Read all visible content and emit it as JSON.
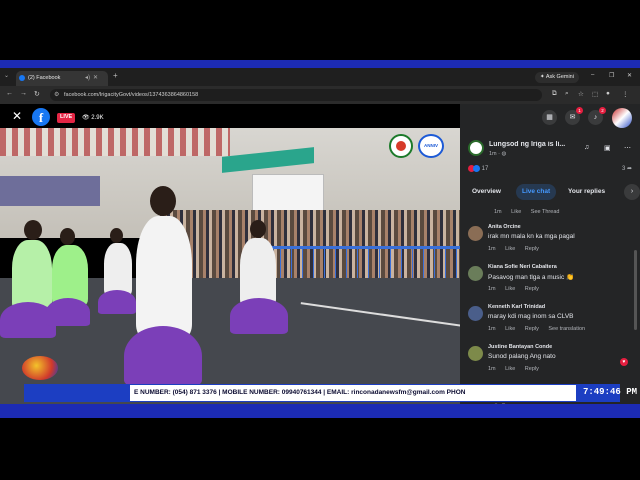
{
  "browser": {
    "tab_title": "(2) Facebook",
    "new_tab": "+",
    "gemini_label": "Ask Gemini",
    "url": "facebook.com/IrigacityGovt/videos/1374363864860158",
    "window_controls": [
      "–",
      "❐",
      "✕"
    ]
  },
  "video": {
    "live_label": "LIVE",
    "viewers": "2.9K",
    "logo2_text": "ANNIV"
  },
  "panel": {
    "notifications_badge": "1",
    "messages_badge": "2",
    "page_name": "Lungsod ng Iriga is li...",
    "page_meta": "1m · ",
    "reactions_count": "17",
    "shares_count": "3",
    "tabs": [
      {
        "label": "Overview"
      },
      {
        "label": "Live chat"
      },
      {
        "label": "Your replies"
      }
    ],
    "first_meta": {
      "time": "1m",
      "like": "Like",
      "see_thread": "See Thread"
    },
    "messages": [
      {
        "name": "Anita Orcine",
        "text": "irak mn mala kn ka mga pagal",
        "time": "1m",
        "like": "Like",
        "reply": "Reply",
        "avatar_color": "#8a6d55"
      },
      {
        "name": "Kiana Sofie Neri Cabaltera",
        "text": "Pasavog man tlga a music 👏",
        "time": "1m",
        "like": "Like",
        "reply": "Reply",
        "avatar_color": "#6a7d5a"
      },
      {
        "name": "Kenneth Karl Trinidad",
        "text": "maray kdi mag inom sa CLVB",
        "time": "1m",
        "like": "Like",
        "reply": "Reply",
        "translate": "See translation",
        "avatar_color": "#4a5e8a"
      },
      {
        "name": "Justine Bantayan Conde",
        "text": "Sunod palang Ang nato",
        "time": "1m",
        "like": "Like",
        "reply": "Reply",
        "avatar_color": "#7d8a4a"
      }
    ]
  },
  "ticker": {
    "text": "E NUMBER: (054) 871 3376  |  MOBILE NUMBER: 09940761344  |  EMAIL: rinconadanewsfm@gmail.com          PHON",
    "time": "7:49:46 PM"
  }
}
